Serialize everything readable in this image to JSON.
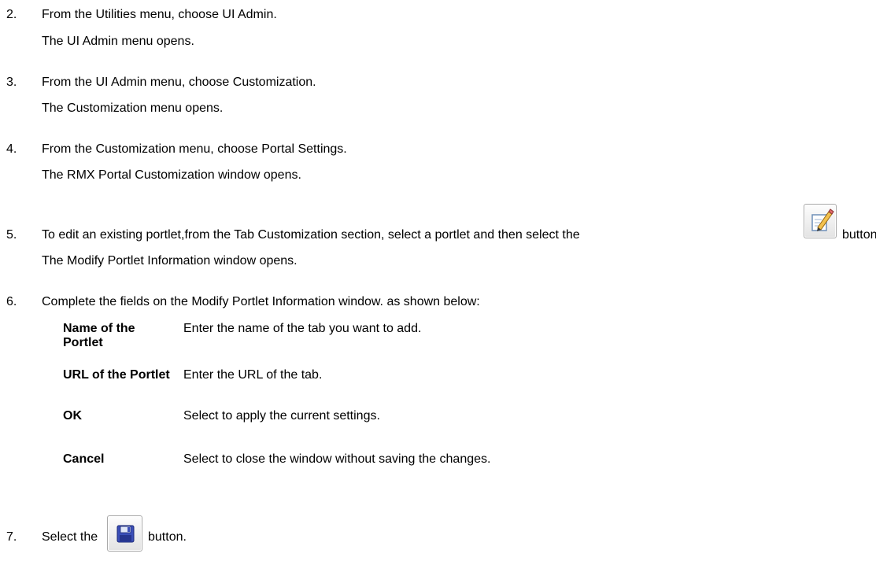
{
  "steps": [
    {
      "num": "2.",
      "text": "From the Utilities menu, choose UI Admin.",
      "result": "The UI Admin menu opens."
    },
    {
      "num": "3.",
      "text": "From the UI Admin menu, choose Customization.",
      "result": "The Customization menu opens."
    },
    {
      "num": "4.",
      "text": "From the Customization menu, choose Portal Settings.",
      "result": "The RMX Portal Customization window opens."
    },
    {
      "num": "5.",
      "text_before": "To edit an existing portlet,from  the Tab Customization section, select a portlet and then select the",
      "text_after": "button.",
      "result": "The Modify Portlet Information window opens."
    },
    {
      "num": "6.",
      "text": "Complete the fields on the Modify Portlet Information window. as shown below:"
    },
    {
      "num": "7.",
      "text_before": "Select the",
      "text_after": "button."
    }
  ],
  "fields": [
    {
      "label": "Name of the Portlet",
      "desc": "Enter the name of the tab you want to add."
    },
    {
      "label": "URL of the Portlet",
      "desc": "Enter the URL of the tab."
    },
    {
      "label": "OK",
      "desc": "Select to apply the current settings."
    },
    {
      "label": "Cancel",
      "desc": "Select to close the window without saving the changes."
    }
  ],
  "icons": {
    "edit_button": "edit-pencil-icon",
    "save_button": "floppy-disk-save-icon"
  }
}
